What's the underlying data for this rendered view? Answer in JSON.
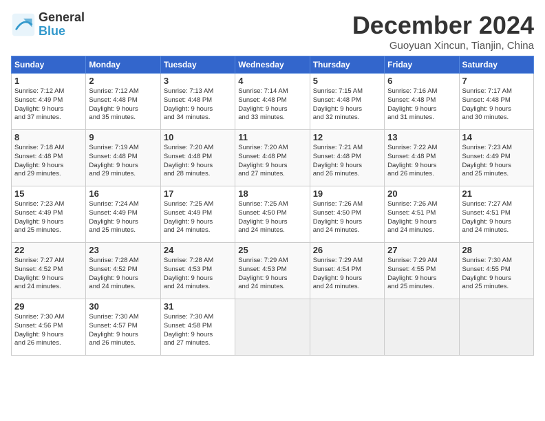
{
  "logo": {
    "line1": "General",
    "line2": "Blue"
  },
  "title": "December 2024",
  "subtitle": "Guoyuan Xincun, Tianjin, China",
  "headers": [
    "Sunday",
    "Monday",
    "Tuesday",
    "Wednesday",
    "Thursday",
    "Friday",
    "Saturday"
  ],
  "weeks": [
    [
      {
        "day": "1",
        "info": "Sunrise: 7:12 AM\nSunset: 4:49 PM\nDaylight: 9 hours\nand 37 minutes."
      },
      {
        "day": "2",
        "info": "Sunrise: 7:12 AM\nSunset: 4:48 PM\nDaylight: 9 hours\nand 35 minutes."
      },
      {
        "day": "3",
        "info": "Sunrise: 7:13 AM\nSunset: 4:48 PM\nDaylight: 9 hours\nand 34 minutes."
      },
      {
        "day": "4",
        "info": "Sunrise: 7:14 AM\nSunset: 4:48 PM\nDaylight: 9 hours\nand 33 minutes."
      },
      {
        "day": "5",
        "info": "Sunrise: 7:15 AM\nSunset: 4:48 PM\nDaylight: 9 hours\nand 32 minutes."
      },
      {
        "day": "6",
        "info": "Sunrise: 7:16 AM\nSunset: 4:48 PM\nDaylight: 9 hours\nand 31 minutes."
      },
      {
        "day": "7",
        "info": "Sunrise: 7:17 AM\nSunset: 4:48 PM\nDaylight: 9 hours\nand 30 minutes."
      }
    ],
    [
      {
        "day": "8",
        "info": "Sunrise: 7:18 AM\nSunset: 4:48 PM\nDaylight: 9 hours\nand 29 minutes."
      },
      {
        "day": "9",
        "info": "Sunrise: 7:19 AM\nSunset: 4:48 PM\nDaylight: 9 hours\nand 29 minutes."
      },
      {
        "day": "10",
        "info": "Sunrise: 7:20 AM\nSunset: 4:48 PM\nDaylight: 9 hours\nand 28 minutes."
      },
      {
        "day": "11",
        "info": "Sunrise: 7:20 AM\nSunset: 4:48 PM\nDaylight: 9 hours\nand 27 minutes."
      },
      {
        "day": "12",
        "info": "Sunrise: 7:21 AM\nSunset: 4:48 PM\nDaylight: 9 hours\nand 26 minutes."
      },
      {
        "day": "13",
        "info": "Sunrise: 7:22 AM\nSunset: 4:48 PM\nDaylight: 9 hours\nand 26 minutes."
      },
      {
        "day": "14",
        "info": "Sunrise: 7:23 AM\nSunset: 4:49 PM\nDaylight: 9 hours\nand 25 minutes."
      }
    ],
    [
      {
        "day": "15",
        "info": "Sunrise: 7:23 AM\nSunset: 4:49 PM\nDaylight: 9 hours\nand 25 minutes."
      },
      {
        "day": "16",
        "info": "Sunrise: 7:24 AM\nSunset: 4:49 PM\nDaylight: 9 hours\nand 25 minutes."
      },
      {
        "day": "17",
        "info": "Sunrise: 7:25 AM\nSunset: 4:49 PM\nDaylight: 9 hours\nand 24 minutes."
      },
      {
        "day": "18",
        "info": "Sunrise: 7:25 AM\nSunset: 4:50 PM\nDaylight: 9 hours\nand 24 minutes."
      },
      {
        "day": "19",
        "info": "Sunrise: 7:26 AM\nSunset: 4:50 PM\nDaylight: 9 hours\nand 24 minutes."
      },
      {
        "day": "20",
        "info": "Sunrise: 7:26 AM\nSunset: 4:51 PM\nDaylight: 9 hours\nand 24 minutes."
      },
      {
        "day": "21",
        "info": "Sunrise: 7:27 AM\nSunset: 4:51 PM\nDaylight: 9 hours\nand 24 minutes."
      }
    ],
    [
      {
        "day": "22",
        "info": "Sunrise: 7:27 AM\nSunset: 4:52 PM\nDaylight: 9 hours\nand 24 minutes."
      },
      {
        "day": "23",
        "info": "Sunrise: 7:28 AM\nSunset: 4:52 PM\nDaylight: 9 hours\nand 24 minutes."
      },
      {
        "day": "24",
        "info": "Sunrise: 7:28 AM\nSunset: 4:53 PM\nDaylight: 9 hours\nand 24 minutes."
      },
      {
        "day": "25",
        "info": "Sunrise: 7:29 AM\nSunset: 4:53 PM\nDaylight: 9 hours\nand 24 minutes."
      },
      {
        "day": "26",
        "info": "Sunrise: 7:29 AM\nSunset: 4:54 PM\nDaylight: 9 hours\nand 24 minutes."
      },
      {
        "day": "27",
        "info": "Sunrise: 7:29 AM\nSunset: 4:55 PM\nDaylight: 9 hours\nand 25 minutes."
      },
      {
        "day": "28",
        "info": "Sunrise: 7:30 AM\nSunset: 4:55 PM\nDaylight: 9 hours\nand 25 minutes."
      }
    ],
    [
      {
        "day": "29",
        "info": "Sunrise: 7:30 AM\nSunset: 4:56 PM\nDaylight: 9 hours\nand 26 minutes."
      },
      {
        "day": "30",
        "info": "Sunrise: 7:30 AM\nSunset: 4:57 PM\nDaylight: 9 hours\nand 26 minutes."
      },
      {
        "day": "31",
        "info": "Sunrise: 7:30 AM\nSunset: 4:58 PM\nDaylight: 9 hours\nand 27 minutes."
      },
      null,
      null,
      null,
      null
    ]
  ]
}
